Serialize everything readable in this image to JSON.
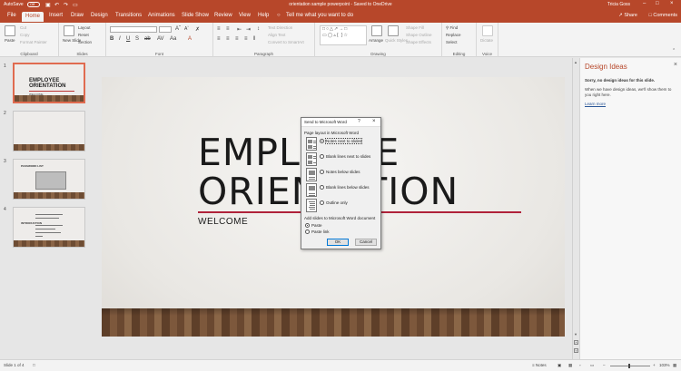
{
  "titlebar": {
    "autosave_label": "AutoSave",
    "autosave_state": "Off",
    "doc_title": "orientation sample powerpoint  -  Saved to OneDrive",
    "search_placeholder": "Tell me what you want to do",
    "user_name": "Tricia Goss"
  },
  "tabs": [
    "File",
    "Home",
    "Insert",
    "Draw",
    "Design",
    "Transitions",
    "Animations",
    "Slide Show",
    "Review",
    "View",
    "Help"
  ],
  "active_tab": "Home",
  "share_label": "Share",
  "comments_label": "Comments",
  "ribbon": {
    "clipboard": {
      "label": "Clipboard",
      "paste": "Paste",
      "cut": "Cut",
      "copy": "Copy",
      "format_painter": "Format Painter"
    },
    "slides": {
      "label": "Slides",
      "new_slide": "New Slide",
      "layout": "Layout",
      "reset": "Reset",
      "section": "Section"
    },
    "font": {
      "label": "Font"
    },
    "paragraph": {
      "label": "Paragraph",
      "text_direction": "Text Direction",
      "align_text": "Align Text",
      "convert_smartart": "Convert to SmartArt"
    },
    "drawing": {
      "label": "Drawing",
      "arrange": "Arrange",
      "quick_styles": "Quick Styles",
      "shape_fill": "Shape Fill",
      "shape_outline": "Shape Outline",
      "shape_effects": "Shape Effects"
    },
    "editing": {
      "label": "Editing",
      "find": "Find",
      "replace": "Replace",
      "select": "Select"
    },
    "voice": {
      "label": "Voice",
      "dictate": "Dictate"
    }
  },
  "thumbnails": [
    {
      "num": "1",
      "title_line1": "EMPLOYEE",
      "title_line2": "ORIENTATION",
      "sub": "WELCOME"
    },
    {
      "num": "2"
    },
    {
      "num": "3",
      "heading": "PASSWORD LIST"
    },
    {
      "num": "4",
      "heading": "INTRODUCTION"
    }
  ],
  "slide": {
    "title_line1": "EMPLOYEE",
    "title_line2": "ORIENTATION",
    "subtitle": "WELCOME"
  },
  "design_ideas": {
    "title": "Design Ideas",
    "sorry": "Sorry, no design ideas for this slide.",
    "message": "When we have design ideas, we'll show them to you right here.",
    "learn_more": "Learn more"
  },
  "dialog": {
    "title": "Send to Microsoft Word",
    "help": "?",
    "page_layout_label": "Page layout in Microsoft Word",
    "options": [
      "Notes next to slides",
      "Blank lines next to slides",
      "Notes below slides",
      "Blank lines below slides",
      "Outline only"
    ],
    "selected_option": 0,
    "add_slides_label": "Add slides to Microsoft Word document",
    "paste_options": [
      "Paste",
      "Paste link"
    ],
    "selected_paste": 0,
    "ok": "OK",
    "cancel": "Cancel"
  },
  "status": {
    "slide_info": "Slide 1 of 4",
    "notes": "Notes",
    "zoom": "103%"
  },
  "colors": {
    "accent": "#b7472a",
    "title_red_line": "#b0223a"
  }
}
